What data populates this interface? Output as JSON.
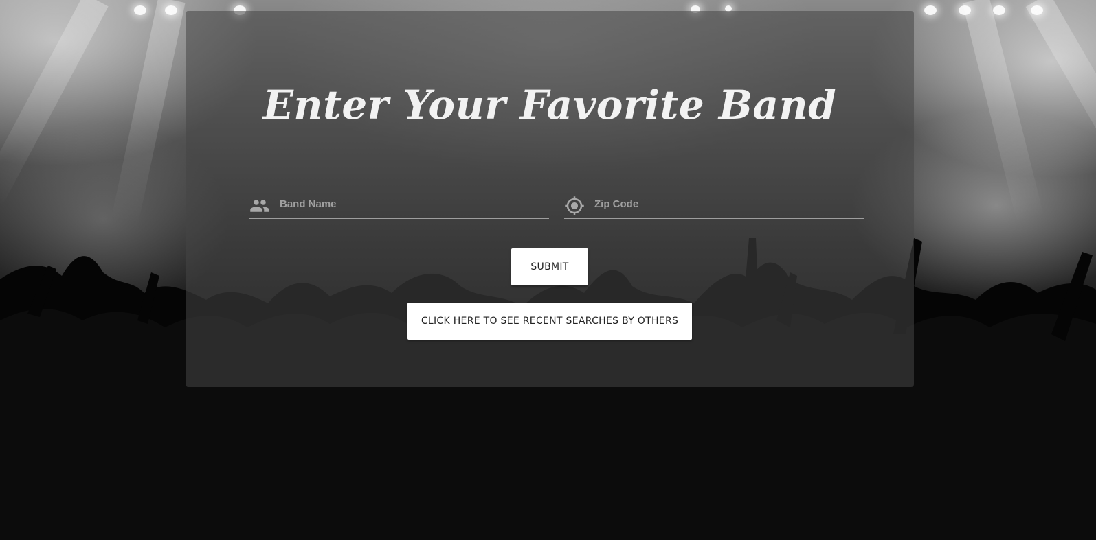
{
  "form": {
    "title": "Enter Your Favorite Band",
    "band_name": {
      "placeholder": "Band Name",
      "value": "",
      "icon": "people-icon"
    },
    "zip_code": {
      "placeholder": "Zip Code",
      "value": "",
      "icon": "location-target-icon"
    },
    "submit_label": "SUBMIT",
    "recent_searches_label": "CLICK HERE TO SEE RECENT SEARCHES BY OTHERS"
  },
  "colors": {
    "panel": "#464646",
    "title_text": "#f2f2f2",
    "icon": "#a8a8a8",
    "button_bg": "#ffffff",
    "button_text": "#222222"
  }
}
